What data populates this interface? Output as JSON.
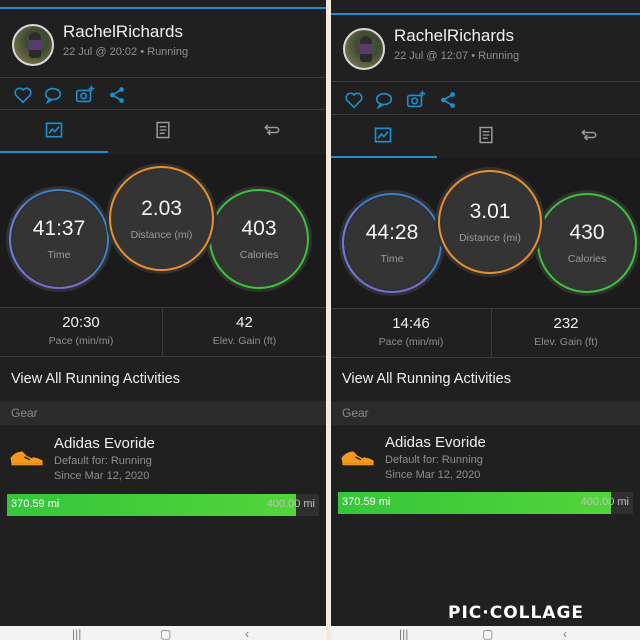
{
  "collage": {
    "watermark": "PIC·COLLAGE"
  },
  "colors": {
    "accent": "#1f8ecd",
    "time_ring": "#3a80c9",
    "distance_ring": "#e8902c",
    "calories_ring": "#3bc43b",
    "gear_bar": "#35c63a"
  },
  "panels": [
    {
      "user": {
        "name": "RachelRichards",
        "meta": "22 Jul @ 20:02 • Running"
      },
      "actions": [
        "heart-icon",
        "comment-icon",
        "add-photo-icon",
        "share-icon"
      ],
      "tabs": [
        "stats-tab-icon",
        "details-tab-icon",
        "laps-tab-icon"
      ],
      "stats": {
        "time": {
          "value": "41:37",
          "label": "Time"
        },
        "distance": {
          "value": "2.03",
          "label": "Distance (mi)"
        },
        "calories": {
          "value": "403",
          "label": "Calories"
        }
      },
      "metrics": {
        "pace": {
          "value": "20:30",
          "label": "Pace (min/mi)"
        },
        "elev": {
          "value": "42",
          "label": "Elev. Gain (ft)"
        }
      },
      "view_all": "View All Running Activities",
      "gear": {
        "header": "Gear",
        "name": "Adidas Evoride",
        "default_for": "Default for: Running",
        "since": "Since Mar 12, 2020",
        "used": "370.59 mi",
        "limit": "400.00 mi",
        "progress": 0.926
      }
    },
    {
      "user": {
        "name": "RachelRichards",
        "meta": "22 Jul @ 12:07 • Running"
      },
      "actions": [
        "heart-icon",
        "comment-icon",
        "add-photo-icon",
        "share-icon"
      ],
      "tabs": [
        "stats-tab-icon",
        "details-tab-icon",
        "laps-tab-icon"
      ],
      "stats": {
        "time": {
          "value": "44:28",
          "label": "Time"
        },
        "distance": {
          "value": "3.01",
          "label": "Distance (mi)"
        },
        "calories": {
          "value": "430",
          "label": "Calories"
        }
      },
      "metrics": {
        "pace": {
          "value": "14:46",
          "label": "Pace (min/mi)"
        },
        "elev": {
          "value": "232",
          "label": "Elev. Gain (ft)"
        }
      },
      "view_all": "View All Running Activities",
      "gear": {
        "header": "Gear",
        "name": "Adidas Evoride",
        "default_for": "Default for: Running",
        "since": "Since Mar 12, 2020",
        "used": "370.59 mi",
        "limit": "400.00 mi",
        "progress": 0.926
      }
    }
  ],
  "navbar": [
    "recents-icon",
    "home-icon",
    "back-icon"
  ]
}
